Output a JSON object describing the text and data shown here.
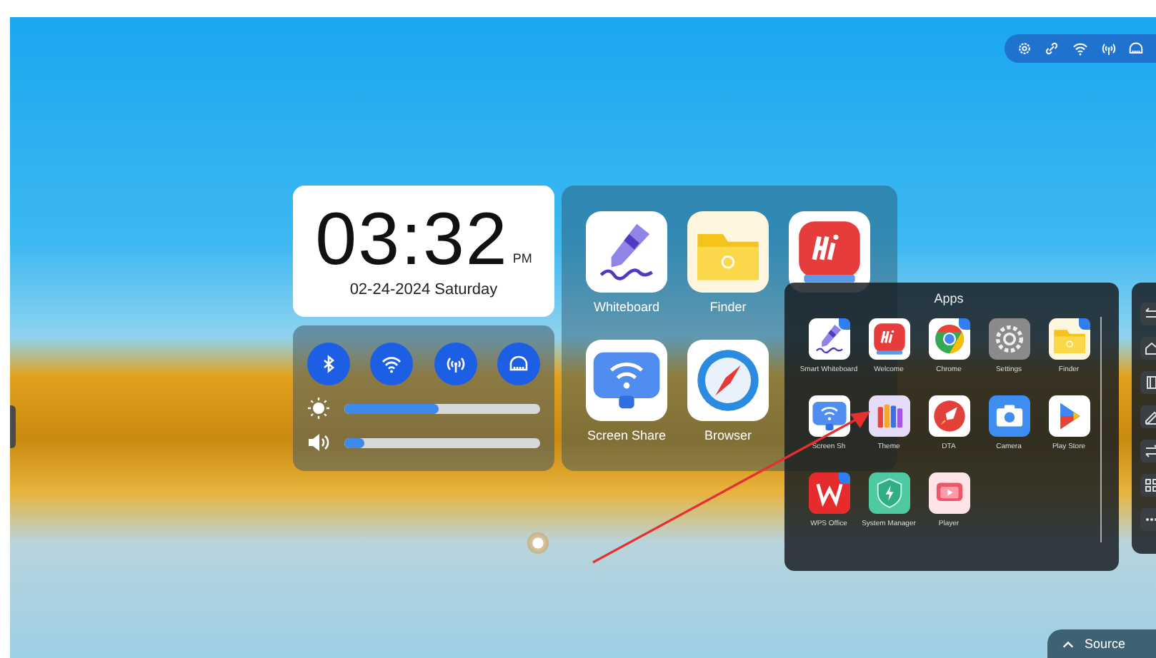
{
  "status_bar": {
    "icons": [
      {
        "kind": "settings"
      },
      {
        "kind": "link"
      },
      {
        "kind": "wifi"
      },
      {
        "kind": "hotspot"
      },
      {
        "kind": "ethernet"
      }
    ]
  },
  "clock": {
    "time": "03:32",
    "meridiem": "PM",
    "date": "02-24-2024 Saturday"
  },
  "quick_settings": {
    "toggles": [
      {
        "kind": "bluetooth",
        "on": true
      },
      {
        "kind": "wifi",
        "on": true
      },
      {
        "kind": "hotspot",
        "on": true
      },
      {
        "kind": "ethernet",
        "on": true
      }
    ],
    "sliders": [
      {
        "kind": "brightness",
        "level": 0.48
      },
      {
        "kind": "volume",
        "level": 0.1
      }
    ]
  },
  "shortcuts": [
    {
      "label": "Whiteboard",
      "kind": "whiteboard"
    },
    {
      "label": "Finder",
      "kind": "finder"
    },
    {
      "kind": "welcome"
    },
    {
      "label": "Screen Share",
      "kind": "screenshare"
    },
    {
      "label": "Browser",
      "kind": "browser"
    }
  ],
  "apps_drawer": {
    "title": "Apps",
    "apps": [
      {
        "label": "Smart Whiteboard",
        "kind": "whiteboard",
        "badge": true
      },
      {
        "label": "Welcome",
        "kind": "welcome",
        "badge": false
      },
      {
        "label": "Chrome",
        "kind": "chrome",
        "badge": true
      },
      {
        "label": "Settings",
        "kind": "settings",
        "badge": false
      },
      {
        "label": "Finder",
        "kind": "finder",
        "badge": true
      },
      {
        "label": "Screen Sh",
        "kind": "screenshare",
        "badge": false
      },
      {
        "label": "Theme",
        "kind": "theme",
        "badge": false
      },
      {
        "label": "DTA",
        "kind": "dta",
        "badge": false
      },
      {
        "label": "Camera",
        "kind": "camera",
        "badge": false
      },
      {
        "label": "Play Store",
        "kind": "playstore",
        "badge": false
      },
      {
        "label": "WPS Office",
        "kind": "wps",
        "badge": true
      },
      {
        "label": "System Manager",
        "kind": "sysmanager",
        "badge": false
      },
      {
        "label": "Player",
        "kind": "player",
        "badge": false
      }
    ]
  },
  "side_toolbar": {
    "icons": [
      {
        "kind": "back"
      },
      {
        "kind": "home"
      },
      {
        "kind": "windows"
      },
      {
        "kind": "pen"
      },
      {
        "kind": "swap"
      },
      {
        "kind": "apps"
      },
      {
        "kind": "more"
      }
    ]
  },
  "source_button": {
    "label": "Source"
  }
}
